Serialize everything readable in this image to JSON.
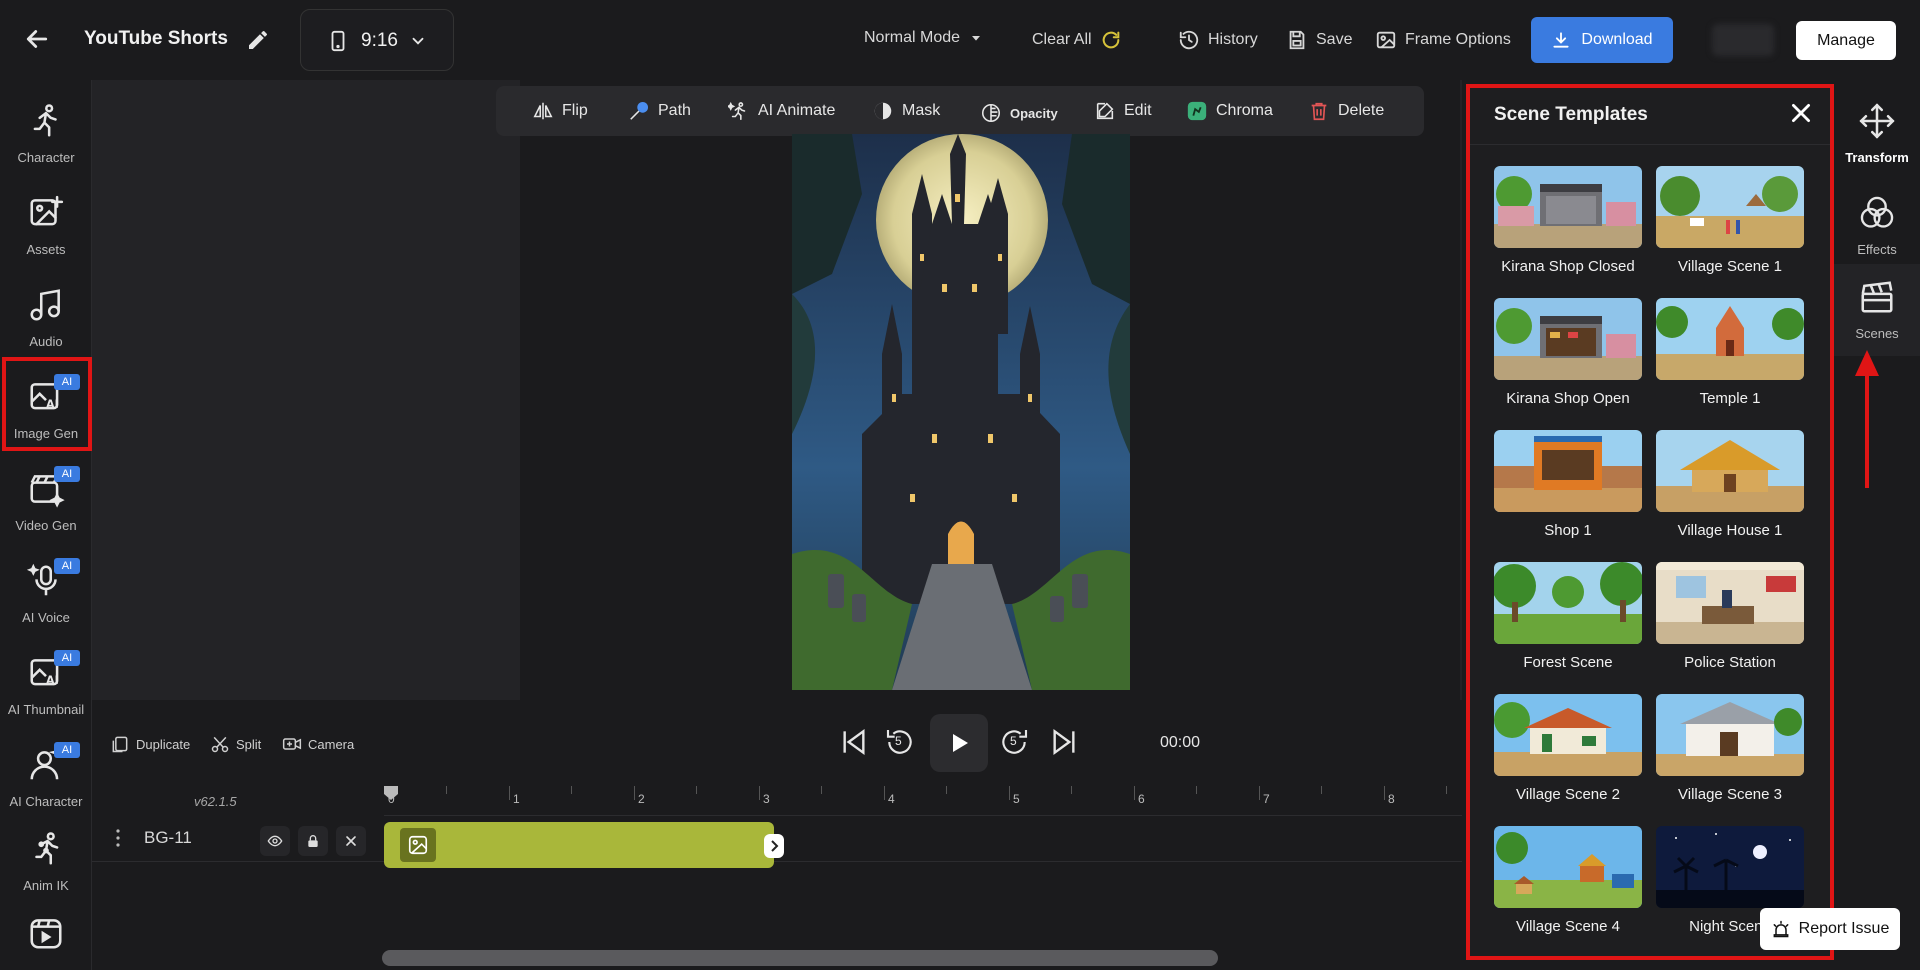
{
  "header": {
    "title": "YouTube Shorts",
    "aspect_ratio": "9:16",
    "mode": "Normal Mode",
    "clear_all": "Clear All",
    "history": "History",
    "save": "Save",
    "frame_options": "Frame Options",
    "download": "Download",
    "manage": "Manage",
    "accent_color": "#3a7be0"
  },
  "sidebar": {
    "items": [
      {
        "label": "Character",
        "icon": "running-figure-icon"
      },
      {
        "label": "Assets",
        "icon": "image-add-icon"
      },
      {
        "label": "Audio",
        "icon": "music-note-icon"
      },
      {
        "label": "Image Gen",
        "icon": "ai-image-icon",
        "badge": "AI"
      },
      {
        "label": "Video Gen",
        "icon": "clapperboard-sparkle-icon",
        "badge": "AI"
      },
      {
        "label": "AI Voice",
        "icon": "microphone-sparkle-icon",
        "badge": "AI"
      },
      {
        "label": "AI Thumbnail",
        "icon": "ai-image-icon",
        "badge": "AI"
      },
      {
        "label": "AI Character",
        "icon": "person-sparkle-icon",
        "badge": "AI"
      },
      {
        "label": "Anim IK",
        "icon": "ik-figure-icon"
      },
      {
        "label": "",
        "icon": "video-player-icon"
      }
    ]
  },
  "toolbar": {
    "items": [
      {
        "label": "Flip",
        "icon": "flip-icon"
      },
      {
        "label": "Path",
        "icon": "path-icon"
      },
      {
        "label": "AI Animate",
        "icon": "ai-animate-icon"
      },
      {
        "label": "Mask",
        "icon": "mask-icon"
      },
      {
        "label": "Opacity",
        "icon": "opacity-icon"
      },
      {
        "label": "Edit",
        "icon": "edit-icon"
      },
      {
        "label": "Chroma",
        "icon": "chroma-icon"
      },
      {
        "label": "Delete",
        "icon": "trash-icon"
      }
    ]
  },
  "playback": {
    "duplicate": "Duplicate",
    "split": "Split",
    "camera": "Camera",
    "skip_back_seconds": "5",
    "skip_forward_seconds": "5",
    "time": "00:00"
  },
  "timeline": {
    "version": "v62.1.5",
    "ruler": [
      "0",
      "1",
      "2",
      "3",
      "4",
      "5",
      "6",
      "7",
      "8"
    ],
    "tracks": [
      {
        "name": "BG-11"
      }
    ]
  },
  "scene_panel": {
    "title": "Scene Templates",
    "templates": [
      {
        "name": "Kirana Shop Closed"
      },
      {
        "name": "Village Scene 1"
      },
      {
        "name": "Kirana Shop Open"
      },
      {
        "name": "Temple 1"
      },
      {
        "name": "Shop 1"
      },
      {
        "name": "Village House 1"
      },
      {
        "name": "Forest Scene"
      },
      {
        "name": "Police Station"
      },
      {
        "name": "Village Scene 2"
      },
      {
        "name": "Village Scene 3"
      },
      {
        "name": "Village Scene 4"
      },
      {
        "name": "Night Scene"
      }
    ]
  },
  "right_rail": {
    "items": [
      {
        "label": "Transform",
        "icon": "move-arrows-icon"
      },
      {
        "label": "Effects",
        "icon": "circles-icon"
      },
      {
        "label": "Scenes",
        "icon": "clapperboard-icon"
      }
    ]
  },
  "report_issue": "Report Issue",
  "annotation_color": "#e01515"
}
